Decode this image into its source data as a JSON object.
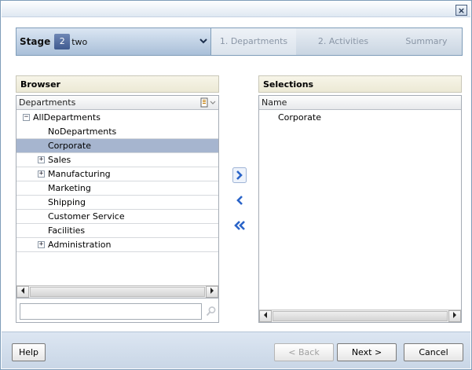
{
  "window": {
    "close_label": "×"
  },
  "stage": {
    "label": "Stage",
    "number": "2",
    "name": "two",
    "steps": [
      "1. Departments",
      "2. Activities",
      "Summary"
    ]
  },
  "browser": {
    "title": "Browser",
    "column_header": "Departments",
    "search_placeholder": "",
    "rows": [
      {
        "label": "AllDepartments",
        "expander": "−",
        "selected": false
      },
      {
        "label": "NoDepartments",
        "expander": "",
        "selected": false
      },
      {
        "label": "Corporate",
        "expander": "",
        "selected": true
      },
      {
        "label": "Sales",
        "expander": "+",
        "selected": false
      },
      {
        "label": "Manufacturing",
        "expander": "+",
        "selected": false
      },
      {
        "label": "Marketing",
        "expander": "",
        "selected": false
      },
      {
        "label": "Shipping",
        "expander": "",
        "selected": false
      },
      {
        "label": "Customer Service",
        "expander": "",
        "selected": false
      },
      {
        "label": "Facilities",
        "expander": "",
        "selected": false
      },
      {
        "label": "Administration",
        "expander": "+",
        "selected": false
      }
    ]
  },
  "selections": {
    "title": "Selections",
    "column_header": "Name",
    "rows": [
      "Corporate"
    ]
  },
  "footer": {
    "help": "Help",
    "back": "< Back",
    "next": "Next >",
    "cancel": "Cancel"
  },
  "colors": {
    "selected_row": "#a6b5cf",
    "accent_blue": "#3f5a8f",
    "shuttle_arrow": "#2a64c8"
  }
}
